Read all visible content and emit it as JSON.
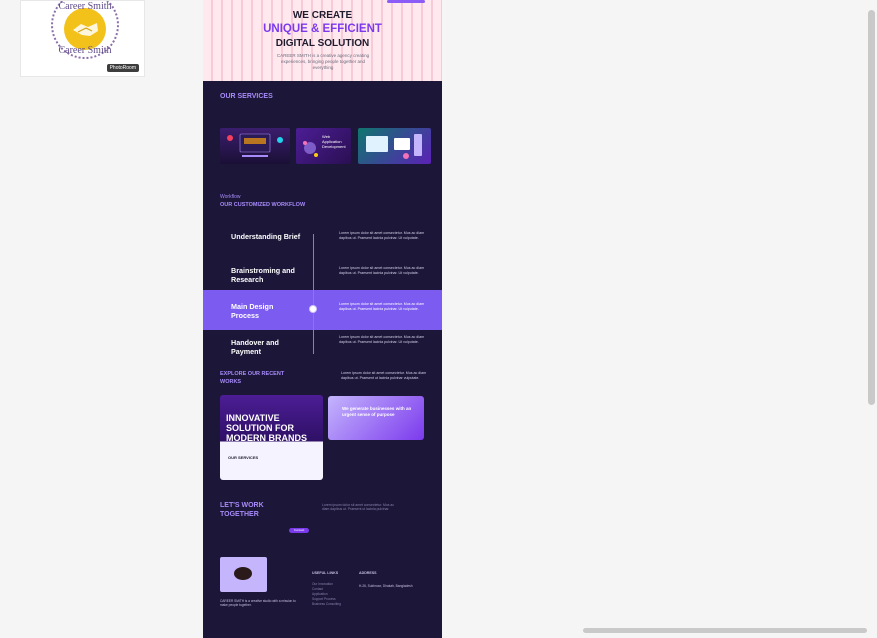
{
  "thumbnail": {
    "logo_top_text": "Career Smith",
    "logo_bottom_text": "Career Smith",
    "badge": "PhotoRoom"
  },
  "hero": {
    "line1": "WE CREATE",
    "line2": "UNIQUE & EFFICIENT",
    "line3": "DIGITAL SOLUTION",
    "subtitle": "CAREER SMITH is a creative agency creating experiences, bringing people together and everything"
  },
  "services": {
    "title": "OUR SERVICES",
    "card2_label": "Web Application Development"
  },
  "workflow": {
    "eyebrow": "Workflow",
    "title": "OUR CUSTOMIZED WORKFLOW",
    "steps": [
      {
        "label": "Understanding Brief",
        "desc": "Lorem ipsum dolor sit amet consectetur. Mus ac diam dapibus ut. Praesent lacinia pulvinar. Ut vulputate."
      },
      {
        "label": "Brainstroming and Research",
        "desc": "Lorem ipsum dolor sit amet consectetur. Mus ac diam dapibus ut. Praesent lacinia pulvinar. Ut vulputate."
      },
      {
        "label": "Main Design Process",
        "desc": "Lorem ipsum dolor sit amet consectetur. Mus ac diam dapibus ut. Praesent lacinia pulvinar. Ut vulputate."
      },
      {
        "label": "Handover and Payment",
        "desc": "Lorem ipsum dolor sit amet consectetur. Mus ac diam dapibus ut. Praesent lacinia pulvinar. Ut vulputate."
      }
    ]
  },
  "works": {
    "title": "EXPLORE OUR RECENT WORKS",
    "desc": "Lorem ipsum dolor sit amet consectetur. Mus ac diam dapibus ut. Praesent ut lacinia pulvinar vulputate.",
    "card1_title": "INNOVATIVE SOLUTION FOR MODERN BRANDS",
    "card1_sub": "OUR SERVICES",
    "card2_title": "We generate businesses with an urgent sense of purpose"
  },
  "cta": {
    "title": "LET'S WORK TOGETHER",
    "desc": "Lorem ipsum dolor sit amet consectetur. Mus ac diam dapibus ut. Praesent ut lacinia pulvinar.",
    "button": "Contact"
  },
  "footer": {
    "desc": "CAREER SMITH is a creative studio with a mission to make people together.",
    "useful_links_head": "USEFUL LINKS",
    "links": [
      "Our Innovation",
      "Contact",
      "Application",
      "Support Process",
      "Business Consulting"
    ],
    "address_head": "ADDRESS",
    "address": "H-26, Sukhnoor, Dhakah, Bangladesh"
  }
}
